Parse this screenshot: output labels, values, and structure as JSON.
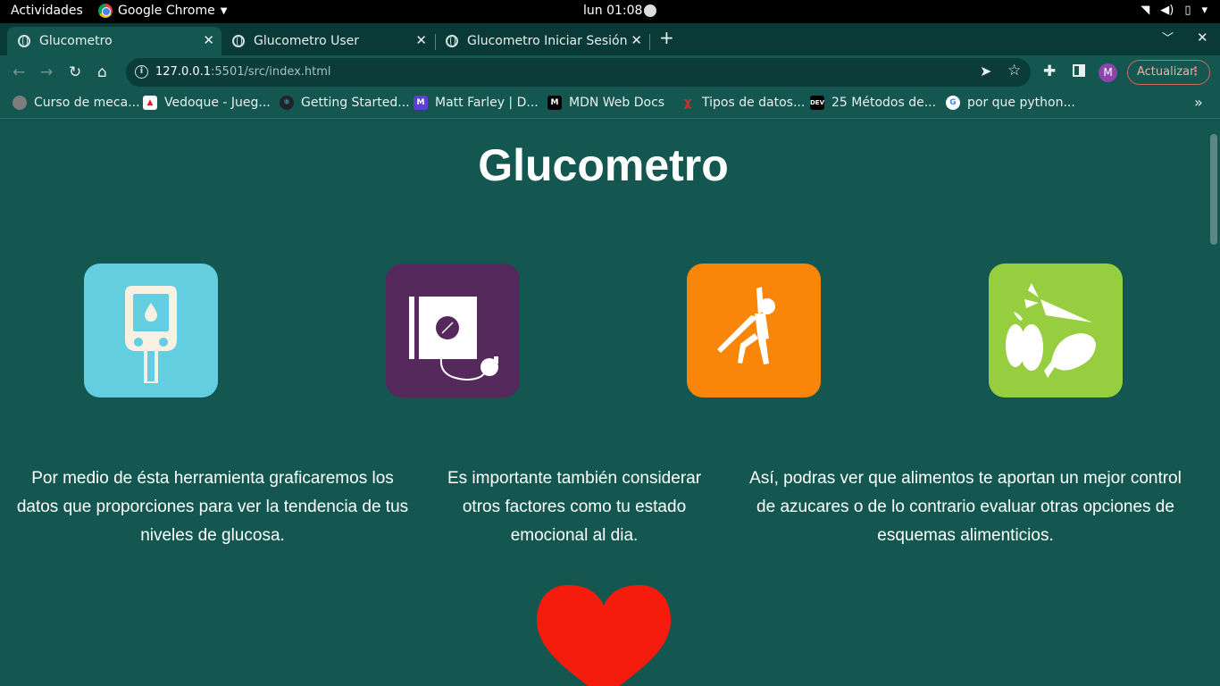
{
  "system_bar": {
    "activities": "Actividades",
    "app_name": "Google Chrome",
    "clock": "lun 01:08",
    "icons": [
      "wifi-icon",
      "volume-icon",
      "battery-icon",
      "power-menu-caret-icon"
    ]
  },
  "tabs": [
    {
      "title": "Glucometro",
      "active": true
    },
    {
      "title": "Glucometro User",
      "active": false
    },
    {
      "title": "Glucometro Iniciar Sesión",
      "active": false
    }
  ],
  "toolbar": {
    "url_host": "127.0.0.1",
    "url_rest": ":5501/src/index.html",
    "avatar_letter": "M",
    "update_label": "Actualizar"
  },
  "bookmarks": [
    {
      "label": "Curso de meca...",
      "icon": "globe-icon"
    },
    {
      "label": "Vedoque - Jueg...",
      "icon": "vedoque-icon"
    },
    {
      "label": "Getting Started...",
      "icon": "react-icon"
    },
    {
      "label": "Matt Farley | D...",
      "icon": "matt-farley-icon"
    },
    {
      "label": "MDN Web Docs",
      "icon": "mdn-icon"
    },
    {
      "label": "Tipos de datos...",
      "icon": "x-icon"
    },
    {
      "label": "25 Métodos de...",
      "icon": "dev-icon"
    },
    {
      "label": "por que python...",
      "icon": "google-icon"
    }
  ],
  "page": {
    "title": "Glucometro",
    "cards": [
      {
        "icon": "glucometer-icon",
        "color": "#63cedf"
      },
      {
        "icon": "blood-pressure-monitor-icon",
        "color": "#55295c"
      },
      {
        "icon": "exercise-stretch-icon",
        "color": "#f98509"
      },
      {
        "icon": "vegetables-icon",
        "color": "#96ce40"
      }
    ],
    "descriptions": [
      "Por medio de ésta herramienta graficaremos los datos que proporciones para ver la tendencia de tus niveles de glucosa.",
      "Es importante también considerar otros factores como tu estado emocional al dia.",
      "Así, podras ver que alimentos te aportan un mejor control de azucares o de lo contrario evaluar otras opciones de esquemas alimenticios."
    ],
    "heart_color": "#f61c0d"
  },
  "colors": {
    "page_background": "#135750",
    "tabstrip_background": "#0a3a37"
  }
}
